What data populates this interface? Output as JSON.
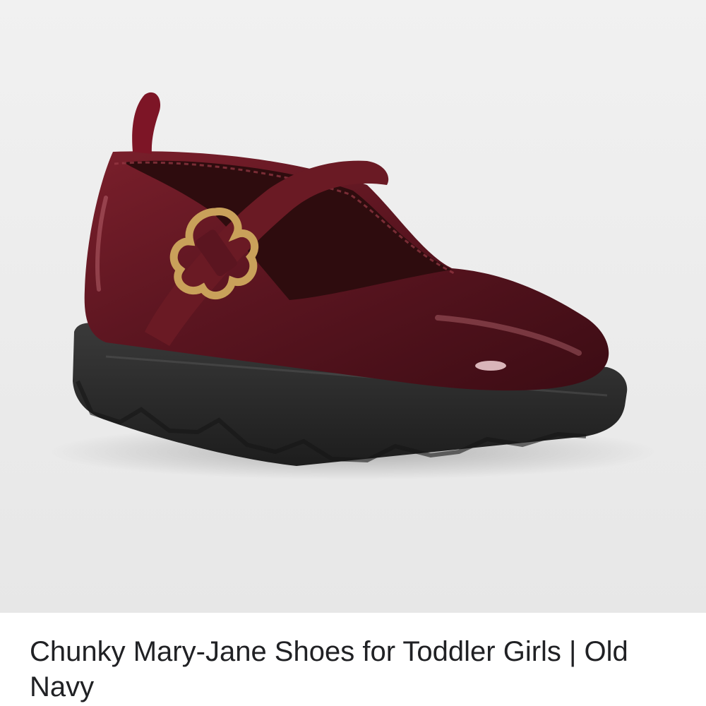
{
  "product": {
    "image_alt": "burgundy patent mary-jane shoe",
    "title": "Chunky Mary-Jane Shoes for Toddler Girls | Old Navy"
  },
  "colors": {
    "background": "#eeeeee",
    "leather": "#5e1620",
    "sole": "#2b2b2b",
    "buckle": "#c9a15a",
    "title_text": "#202124"
  }
}
